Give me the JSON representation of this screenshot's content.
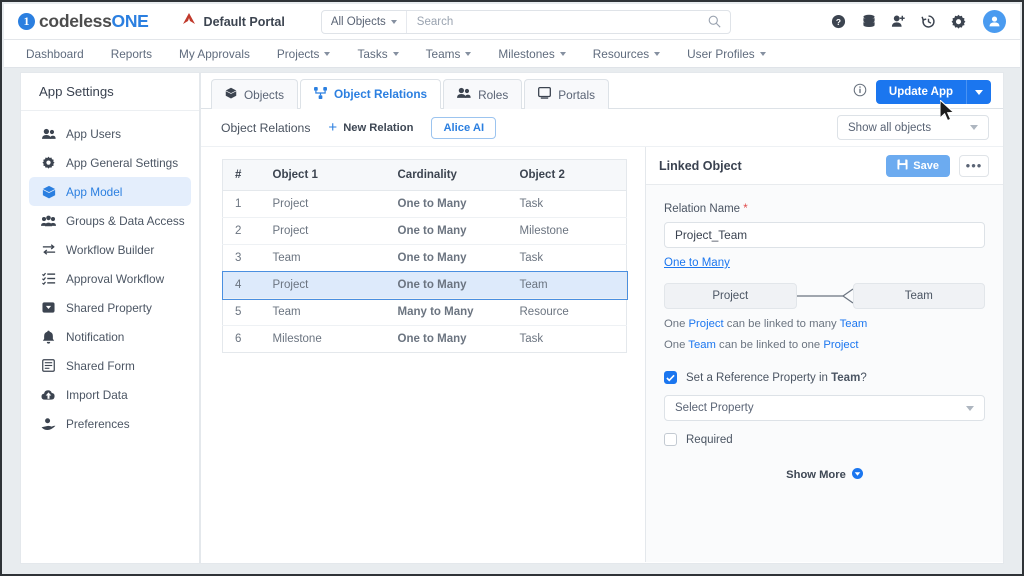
{
  "topbar": {
    "logo_mark": "1",
    "logo_text_a": "codeless",
    "logo_text_b": "ONE",
    "portal_icon": "portal-logo-icon",
    "portal_label": "Default Portal",
    "search": {
      "scope_label": "All Objects",
      "placeholder": "Search",
      "value": "",
      "icon": "search-icon"
    },
    "icons": [
      {
        "name": "help-icon",
        "glyph": "?"
      },
      {
        "name": "database-icon",
        "glyph": ""
      },
      {
        "name": "add-user-icon",
        "glyph": ""
      },
      {
        "name": "history-icon",
        "glyph": ""
      },
      {
        "name": "gear-icon",
        "glyph": ""
      }
    ],
    "avatar_icon": "user-avatar-icon"
  },
  "nav": {
    "items": [
      {
        "label": "Dashboard",
        "has_caret": false
      },
      {
        "label": "Reports",
        "has_caret": false
      },
      {
        "label": "My Approvals",
        "has_caret": false
      },
      {
        "label": "Projects",
        "has_caret": true
      },
      {
        "label": "Tasks",
        "has_caret": true
      },
      {
        "label": "Teams",
        "has_caret": true
      },
      {
        "label": "Milestones",
        "has_caret": true
      },
      {
        "label": "Resources",
        "has_caret": true
      },
      {
        "label": "User Profiles",
        "has_caret": true
      }
    ]
  },
  "sidebar": {
    "title": "App Settings",
    "items": [
      {
        "label": "App Users",
        "icon": "users-icon",
        "active": false
      },
      {
        "label": "App General Settings",
        "icon": "gear-icon",
        "active": false
      },
      {
        "label": "App Model",
        "icon": "cube-icon",
        "active": true
      },
      {
        "label": "Groups & Data Access",
        "icon": "group-access-icon",
        "active": false
      },
      {
        "label": "Workflow Builder",
        "icon": "workflow-arrows-icon",
        "active": false
      },
      {
        "label": "Approval Workflow",
        "icon": "checklist-icon",
        "active": false
      },
      {
        "label": "Shared Property",
        "icon": "shared-property-icon",
        "active": false
      },
      {
        "label": "Notification",
        "icon": "bell-icon",
        "active": false
      },
      {
        "label": "Shared Form",
        "icon": "form-icon",
        "active": false
      },
      {
        "label": "Import Data",
        "icon": "cloud-upload-icon",
        "active": false
      },
      {
        "label": "Preferences",
        "icon": "preferences-icon",
        "active": false
      }
    ]
  },
  "main": {
    "tabs": [
      {
        "label": "Objects",
        "icon": "cube-icon",
        "active": false
      },
      {
        "label": "Object Relations",
        "icon": "relations-icon",
        "active": true
      },
      {
        "label": "Roles",
        "icon": "people-icon",
        "active": false
      },
      {
        "label": "Portals",
        "icon": "screen-icon",
        "active": false
      }
    ],
    "info_icon": "info-icon",
    "update_button": {
      "label": "Update App",
      "dropdown_icon": "chevron-down-icon",
      "color": "#1b76ef"
    },
    "subheader": {
      "title": "Object Relations",
      "new_relation_label": "New Relation",
      "new_relation_icon": "plus-icon",
      "alice_ai_label": "Alice AI",
      "filter_label": "Show all objects",
      "filter_icon": "chevron-down-icon"
    },
    "table": {
      "columns": [
        "#",
        "Object 1",
        "Cardinality",
        "Object 2"
      ],
      "rows": [
        {
          "num": "1",
          "object1": "Project",
          "cardinality": "One to Many",
          "object2": "Task",
          "selected": false
        },
        {
          "num": "2",
          "object1": "Project",
          "cardinality": "One to Many",
          "object2": "Milestone",
          "selected": false
        },
        {
          "num": "3",
          "object1": "Team",
          "cardinality": "One to Many",
          "object2": "Task",
          "selected": false
        },
        {
          "num": "4",
          "object1": "Project",
          "cardinality": "One to Many",
          "object2": "Team",
          "selected": true
        },
        {
          "num": "5",
          "object1": "Team",
          "cardinality": "Many to Many",
          "object2": "Resource",
          "selected": false
        },
        {
          "num": "6",
          "object1": "Milestone",
          "cardinality": "One to Many",
          "object2": "Task",
          "selected": false
        }
      ]
    }
  },
  "detail": {
    "title": "Linked Object",
    "save_label": "Save",
    "save_icon": "floppy-disk-icon",
    "more_label": "•••",
    "relation_name_label": "Relation Name",
    "required_marker": "*",
    "relation_name_value": "Project_Team",
    "cardinality_link": "One to Many",
    "diagram": {
      "left": "Project",
      "right": "Team",
      "connector": "crowsfoot-one-to-many-icon"
    },
    "desc_line1": {
      "pre": "One ",
      "a": "Project",
      "mid": " can be linked to many ",
      "b": "Team"
    },
    "desc_line2": {
      "pre": "One ",
      "a": "Team",
      "mid": " can be linked to one ",
      "b": "Project"
    },
    "ref_checkbox": {
      "checked": true,
      "pre": "Set a Reference Property in ",
      "bold": "Team",
      "post": "?"
    },
    "select_property_label": "Select Property",
    "required_checkbox": {
      "checked": false,
      "label": "Required"
    },
    "show_more_label": "Show More",
    "show_more_icon": "chevron-down-circle-icon"
  }
}
